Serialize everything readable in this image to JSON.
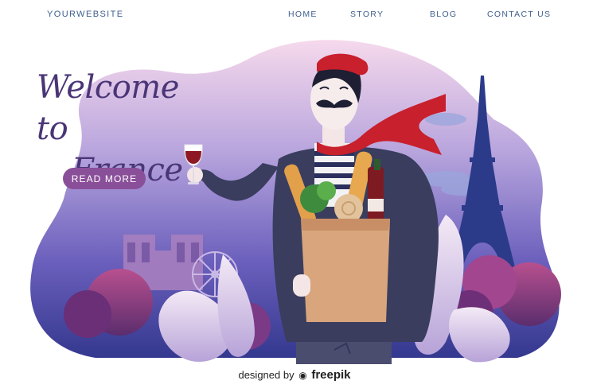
{
  "nav": {
    "brand": "YOURWEBSITE",
    "items": [
      "HOME",
      "STORY",
      "BLOG",
      "CONTACT US"
    ]
  },
  "hero": {
    "title_line1": "Welcome to",
    "title_line2": "France",
    "cta_label": "READ MORE"
  },
  "credit": {
    "prefix": "designed by",
    "brand": "freepik"
  },
  "colors": {
    "nav_text": "#3f5f8f",
    "title": "#4a3577",
    "button": "#8a4f99",
    "scarf": "#c8202c",
    "sky_top": "#f3d7ea",
    "sky_bottom": "#3b3f9a"
  },
  "icons": [
    "wine-glass-icon",
    "eiffel-tower-icon",
    "ferris-wheel-icon",
    "freepik-logo-icon"
  ]
}
